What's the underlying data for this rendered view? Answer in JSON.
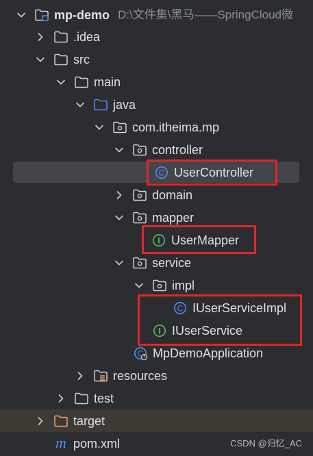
{
  "tree": {
    "project": {
      "name": "mp-demo",
      "path": "D:\\文件集\\黑马——SpringCloud微"
    },
    "idea": ".idea",
    "src": "src",
    "main": "main",
    "java": "java",
    "package": "com.itheima.mp",
    "controller": "controller",
    "user_controller": "UserController",
    "domain": "domain",
    "mapper": "mapper",
    "user_mapper": "UserMapper",
    "service": "service",
    "impl": "impl",
    "iuser_service_impl": "IUserServiceImpl",
    "iuser_service": "IUserService",
    "app": "MpDemoApplication",
    "resources": "resources",
    "test": "test",
    "target": "target",
    "pom": "pom.xml"
  },
  "icons": {
    "class_letter": "C",
    "interface_letter": "I",
    "maven_letter": "m"
  },
  "colors": {
    "background": "#2b2d30",
    "selection": "#43454a",
    "excluded_row": "#3d3a34",
    "highlight_box": "#e0262a",
    "class_icon": "#548af7",
    "interface_icon": "#5fb865",
    "folder_icon": "#ced0d6",
    "excluded_folder": "#e8a36b",
    "maven_icon": "#4d8cf7"
  },
  "watermark": "CSDN @归忆_AC"
}
